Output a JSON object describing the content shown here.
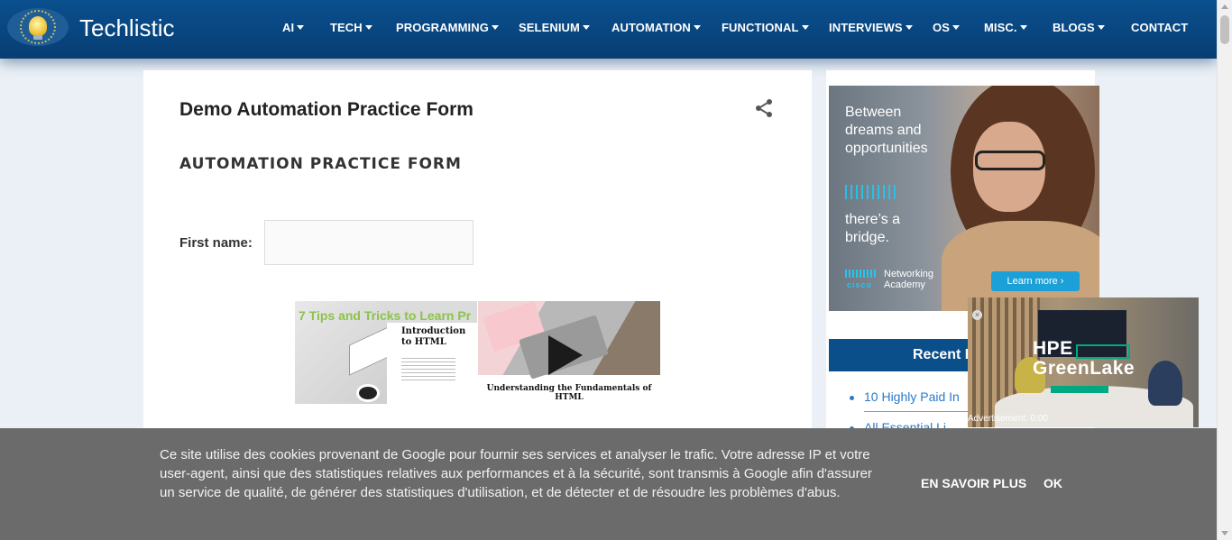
{
  "header": {
    "brand": "Techlistic",
    "nav": [
      {
        "label": "AI",
        "dropdown": true
      },
      {
        "label": "TECH",
        "dropdown": true
      },
      {
        "label": "PROGRAMMING",
        "dropdown": true
      },
      {
        "label": "SELENIUM",
        "dropdown": true
      },
      {
        "label": "AUTOMATION",
        "dropdown": true
      },
      {
        "label": "FUNCTIONAL",
        "dropdown": true
      },
      {
        "label": "INTERVIEWS",
        "dropdown": true
      },
      {
        "label": "OS",
        "dropdown": true
      },
      {
        "label": "MISC.",
        "dropdown": true
      },
      {
        "label": "BLOGS",
        "dropdown": true
      },
      {
        "label": "CONTACT",
        "dropdown": false
      }
    ]
  },
  "main": {
    "title": "Demo Automation Practice Form",
    "form_heading": "AUTOMATION PRACTICE FORM",
    "first_name_label": "First name:",
    "first_name_value": "",
    "thumbnails": [
      {
        "overlay": "7 Tips and Tricks to Learn Pr",
        "title": "Introduction to HTML"
      },
      {
        "caption": "Understanding the Fundamentals of HTML"
      }
    ]
  },
  "sidebar": {
    "ad": {
      "line1": "Between dreams and opportunities",
      "line2": "there’s a bridge.",
      "brand": "cisco",
      "academy": "Networking Academy",
      "cta": "Learn more ›"
    },
    "recent_title": "Recent B",
    "recent_items": [
      "10 Highly Paid In",
      "All Essential Li"
    ]
  },
  "video_ad": {
    "brand_line1": "HPE",
    "brand_line2": "GreenLake",
    "close": "×",
    "status": "Advertisement: 0:00"
  },
  "cookie": {
    "text": "Ce site utilise des cookies provenant de Google pour fournir ses services et analyser le trafic. Votre adresse IP et votre user-agent, ainsi que des statistiques relatives aux performances et à la sécurité, sont transmis à Google afin d'assurer un service de qualité, de générer des statistiques d'utilisation, et de détecter et de résoudre les problèmes d'abus.",
    "learn_more": "EN SAVOIR PLUS",
    "ok": "OK"
  },
  "colors": {
    "header": "#0a4f8e",
    "recent_bar": "#0b4f8a",
    "link": "#2a7ac9",
    "cookie_bg": "#6b6b6b"
  }
}
